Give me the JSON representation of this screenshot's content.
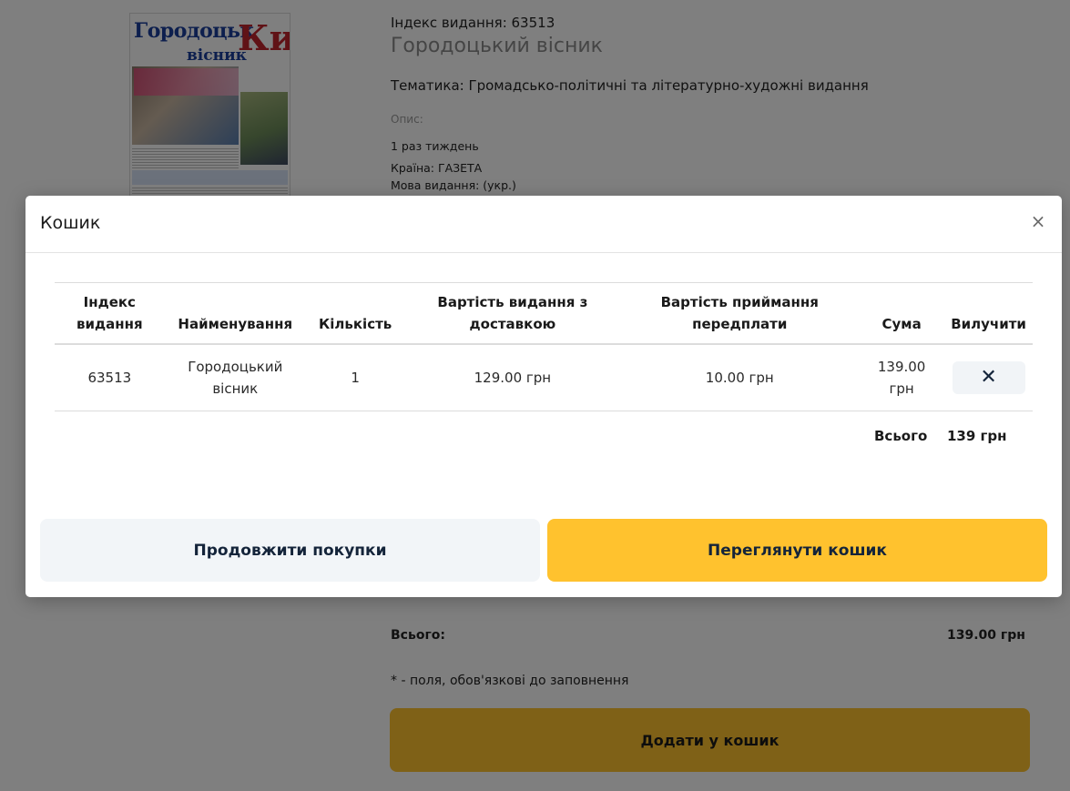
{
  "background": {
    "cover": {
      "title_top": "Городоцьк",
      "title_k": "Кий",
      "title_sub": "вісник"
    },
    "index_line": "Індекс видання: 63513",
    "title": "Городоцький вісник",
    "topic": "Тематика: Громадсько-політичні та літературно-художні видання",
    "description_label": "Опис:",
    "frequency": "1 раз тиждень",
    "country": "Країна: ГАЗЕТА",
    "language": "Мова видання: (укр.)",
    "total_label": "Всього:",
    "total_value": "139.00 грн",
    "required_note": "* - поля, обов'язкові до заповнення",
    "add_to_cart": "Додати у кошик"
  },
  "modal": {
    "title": "Кошик",
    "close": "×",
    "columns": [
      "Індекс видання",
      "Найменування",
      "Кількість",
      "Вартість видання з доставкою",
      "Вартість приймання передплати",
      "Сума",
      "Вилучити"
    ],
    "rows": [
      {
        "index": "63513",
        "name": "Городоцький вісник",
        "quantity": "1",
        "price": "129.00 грн",
        "fee": "10.00 грн",
        "sum": "139.00 грн",
        "remove": "✕"
      }
    ],
    "total_label": "Всього",
    "total_value": "139 грн",
    "continue_label": "Продовжити покупки",
    "view_cart_label": "Переглянути кошик"
  },
  "colors": {
    "accent": "#ffc22e",
    "dark_text": "#14243a",
    "overlay": "rgba(0,0,0,0.5)"
  }
}
